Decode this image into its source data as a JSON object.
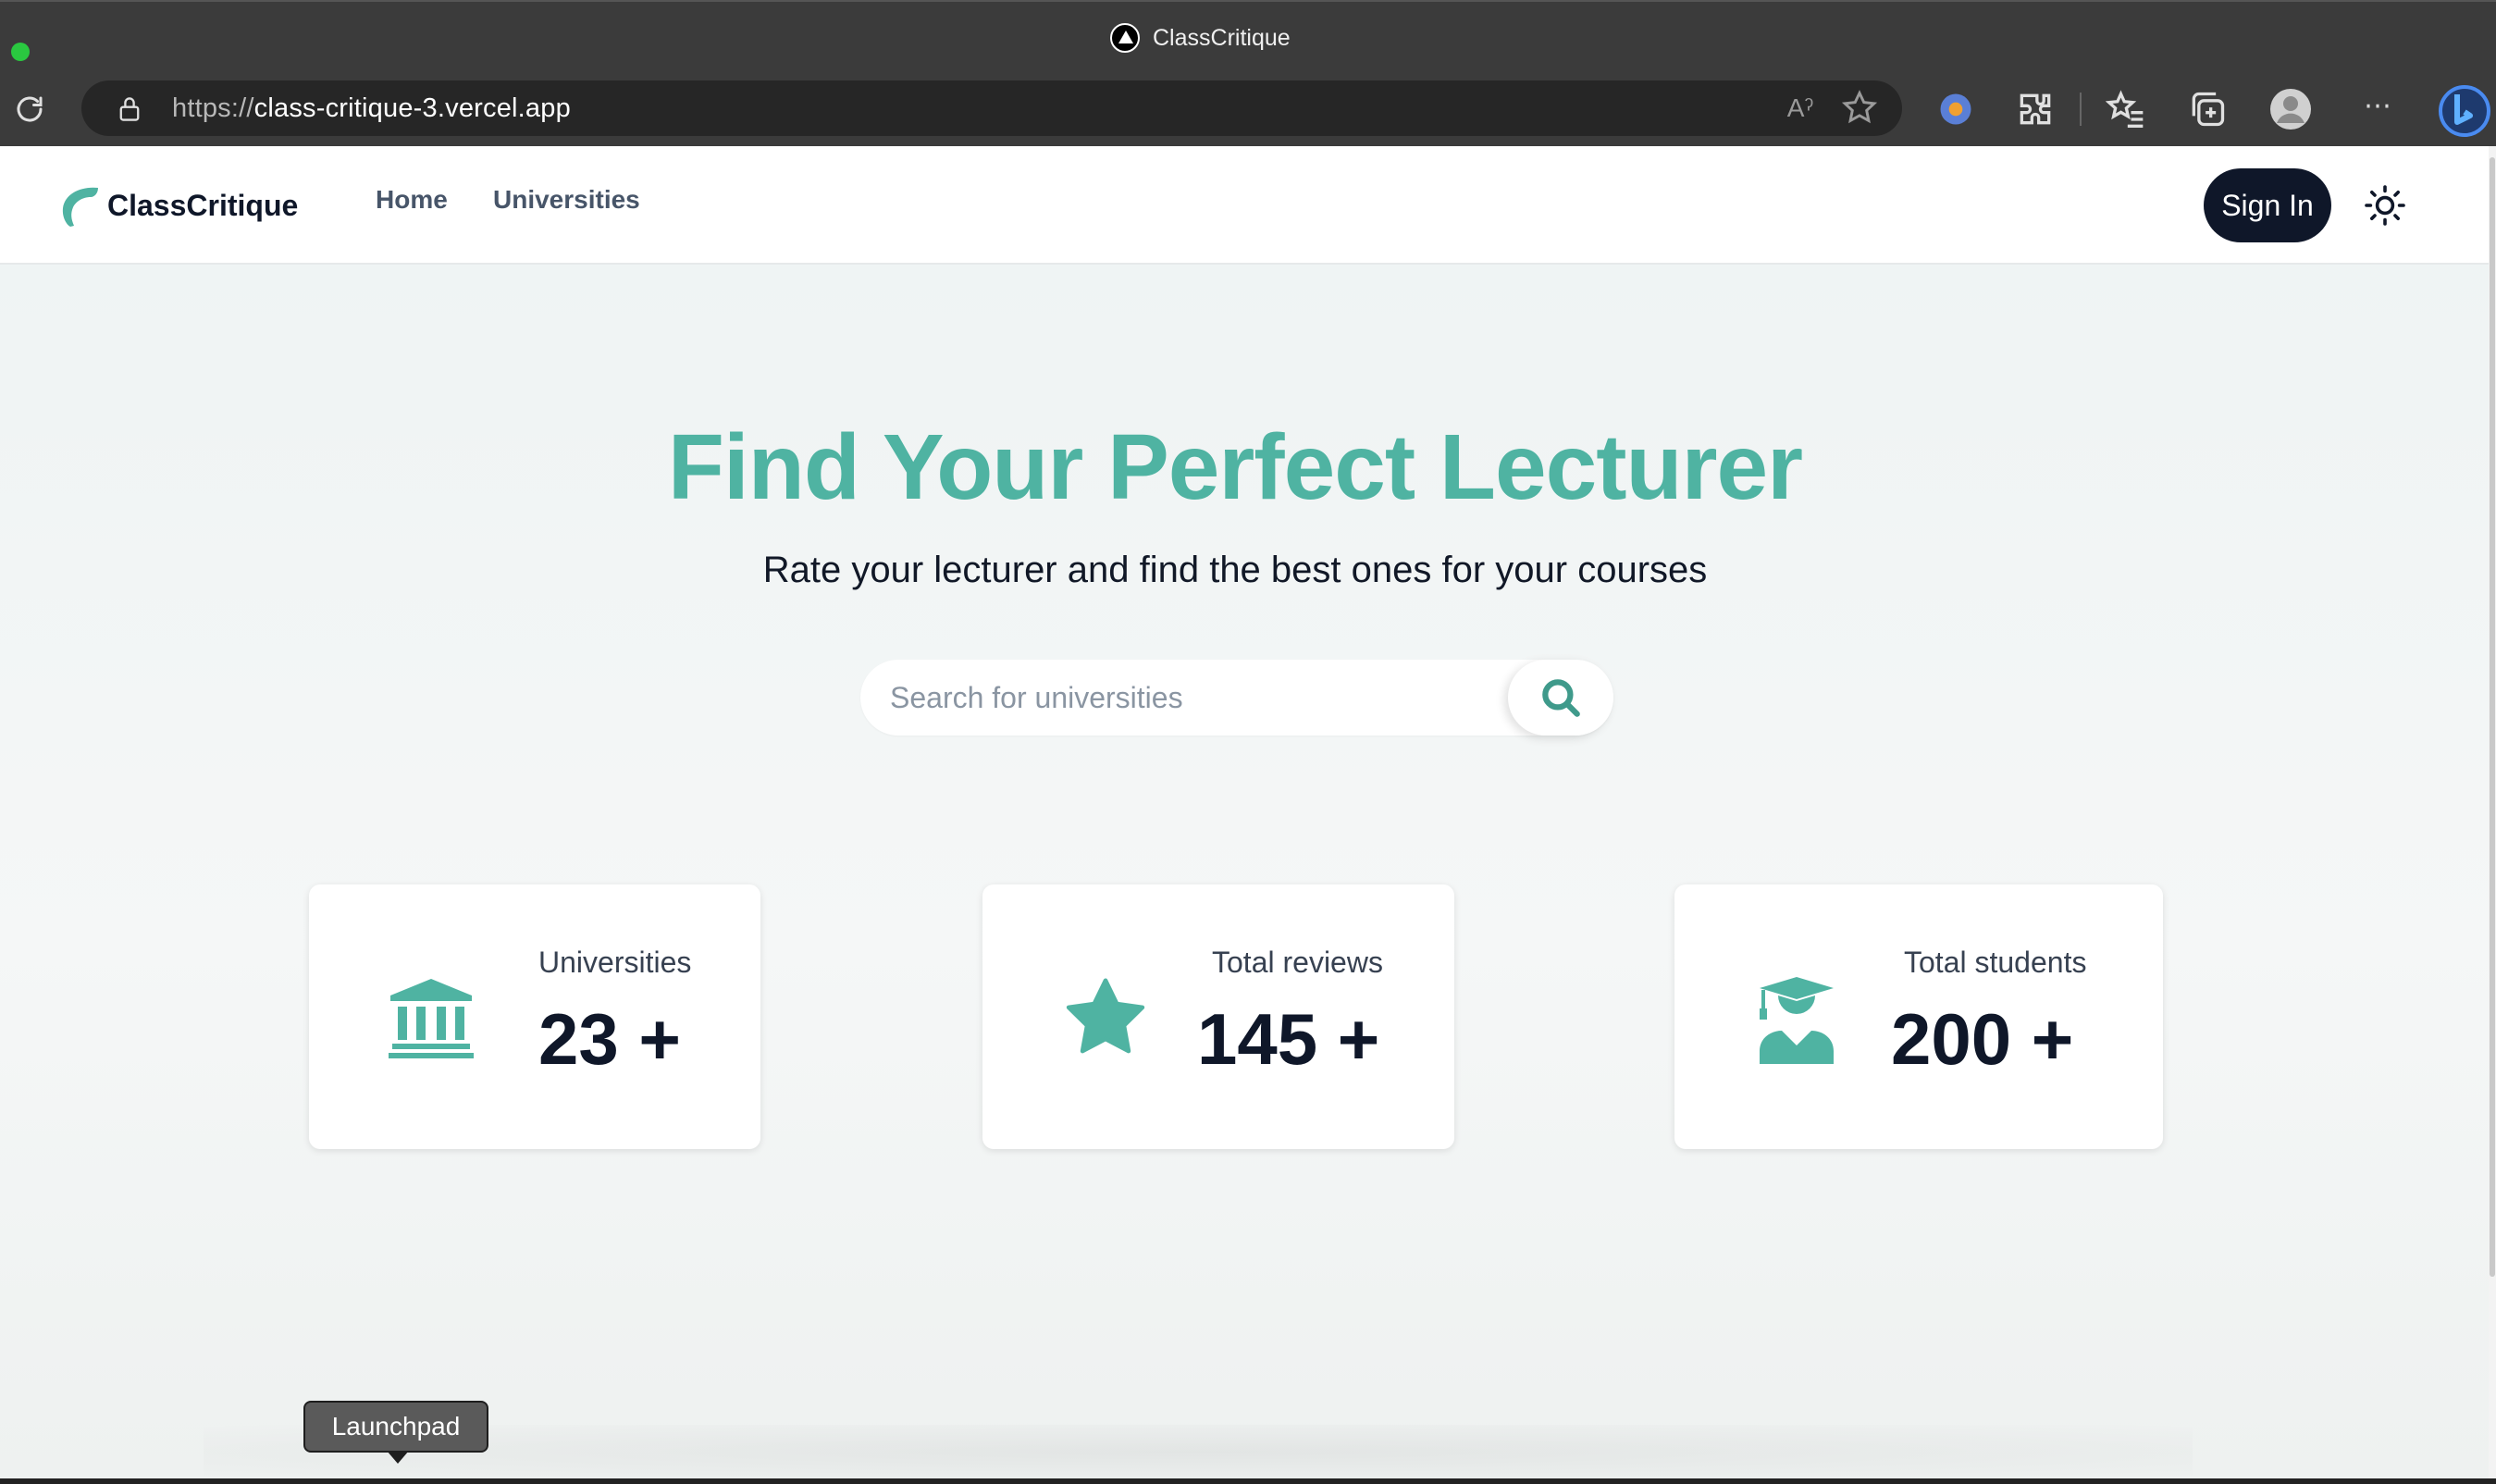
{
  "browser": {
    "tab_title": "ClassCritique",
    "url_protocol": "https://",
    "url_host": "class-critique-3.vercel.app"
  },
  "navbar": {
    "brand": "ClassCritique",
    "links": [
      "Home",
      "Universities"
    ],
    "signin_label": "Sign In"
  },
  "hero": {
    "title": "Find Your Perfect Lecturer",
    "subtitle": "Rate your lecturer and find the best ones for your courses",
    "search_placeholder": "Search for universities"
  },
  "stats": [
    {
      "label": "Universities",
      "value": "23 +",
      "icon": "university-icon"
    },
    {
      "label": "Total reviews",
      "value": "145 +",
      "icon": "star-icon"
    },
    {
      "label": "Total students",
      "value": "200 +",
      "icon": "graduate-icon"
    }
  ],
  "dock": {
    "tooltip": "Launchpad"
  },
  "colors": {
    "accent": "#4fb3a2",
    "dark": "#0f1729",
    "chrome": "#3b3b3b"
  }
}
